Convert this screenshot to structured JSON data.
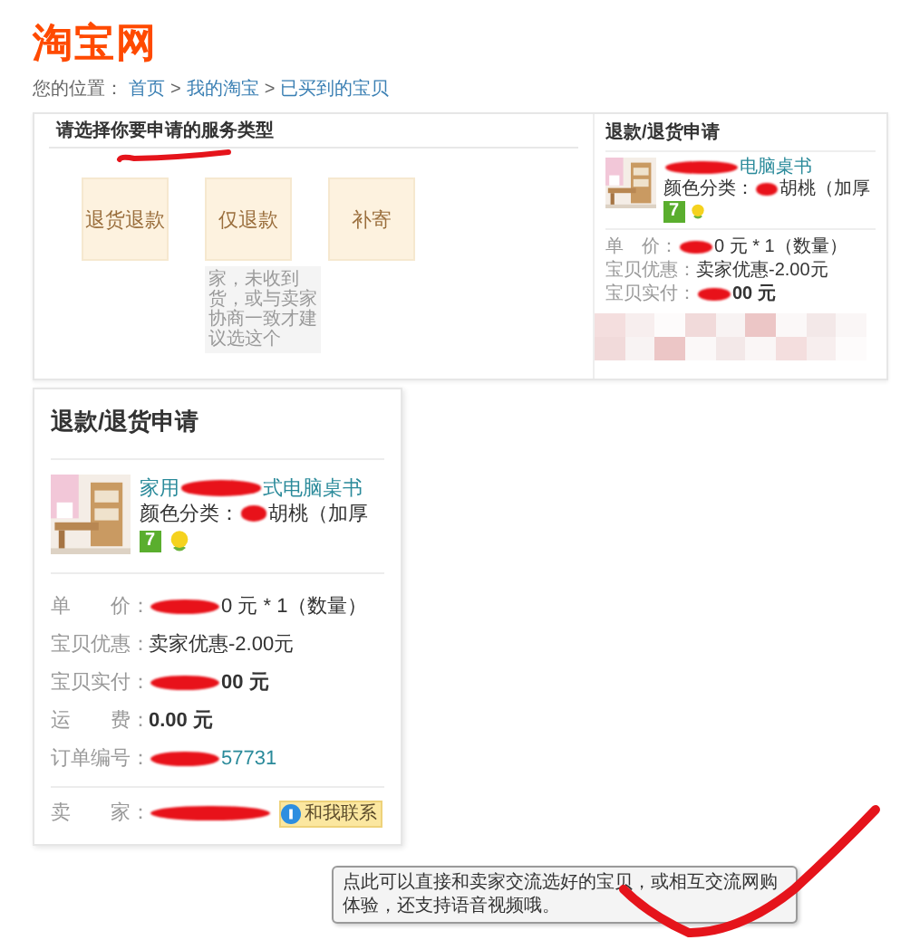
{
  "logo": {
    "text": "淘宝网"
  },
  "breadcrumb": {
    "label": "您的位置：",
    "separator": ">",
    "links": [
      "首页",
      "我的淘宝",
      "已买到的宝贝"
    ]
  },
  "service_panel": {
    "title": "请选择你要申请的服务类型",
    "options": [
      {
        "label": "退货退款"
      },
      {
        "label": "仅退款",
        "note": "家，未收到货，或与卖家协商一致才建议选这个"
      },
      {
        "label": "补寄"
      }
    ]
  },
  "summary": {
    "title": "退款/退货申请",
    "product": {
      "title": [
        {
          "kind": "redacted"
        },
        {
          "kind": "text",
          "text": "电脑桌书"
        }
      ],
      "color": [
        {
          "kind": "text",
          "text": "颜色分类："
        },
        {
          "kind": "redacted"
        },
        {
          "kind": "text",
          "text": "胡桃（加厚"
        }
      ],
      "badge": "7"
    },
    "rows": [
      {
        "kind": "plain",
        "label": "单　价：",
        "value": [
          {
            "kind": "redacted"
          },
          {
            "kind": "text",
            "text": "0 元 * 1（数量）"
          }
        ]
      },
      {
        "kind": "plain",
        "label": "宝贝优惠：",
        "value": [
          {
            "kind": "text",
            "text": "卖家优惠-2.00元"
          }
        ]
      },
      {
        "kind": "bold",
        "label": "宝贝实付：",
        "value": [
          {
            "kind": "redacted"
          },
          {
            "kind": "text",
            "text": "00 元"
          }
        ]
      }
    ],
    "censored": true
  },
  "card": {
    "title": "退款/退货申请",
    "product": {
      "title": [
        {
          "kind": "text",
          "text": "家用"
        },
        {
          "kind": "redacted"
        },
        {
          "kind": "text",
          "text": "式电脑桌书"
        }
      ],
      "color": [
        {
          "kind": "text",
          "text": "颜色分类："
        },
        {
          "kind": "redacted"
        },
        {
          "kind": "text",
          "text": "胡桃（加厚"
        }
      ],
      "badge": "7"
    },
    "rows": [
      {
        "kind": "plain",
        "label": "单　　价：",
        "value": [
          {
            "kind": "redacted"
          },
          {
            "kind": "text",
            "text": "0 元 * 1（数量）"
          }
        ]
      },
      {
        "kind": "plain",
        "label": "宝贝优惠：",
        "value": [
          {
            "kind": "text",
            "text": "卖家优惠-2.00元"
          }
        ]
      },
      {
        "kind": "bold",
        "label": "宝贝实付：",
        "value": [
          {
            "kind": "redacted"
          },
          {
            "kind": "text",
            "text": "00 元"
          }
        ]
      },
      {
        "kind": "bold",
        "label": "运　　费：",
        "value": [
          {
            "kind": "text",
            "text": "0.00 元"
          }
        ]
      },
      {
        "kind": "link",
        "label": "订单编号：",
        "value": [
          {
            "kind": "redacted"
          },
          {
            "kind": "text",
            "text": "57731"
          }
        ]
      },
      {
        "kind": "seller",
        "label": "卖　　家：",
        "value": [
          {
            "kind": "redacted"
          }
        ],
        "button": "和我联系"
      }
    ]
  },
  "tooltip": {
    "text": "点此可以直接和卖家交流选好的宝贝，或相互交流网购体验，还支持语音视频哦。"
  }
}
